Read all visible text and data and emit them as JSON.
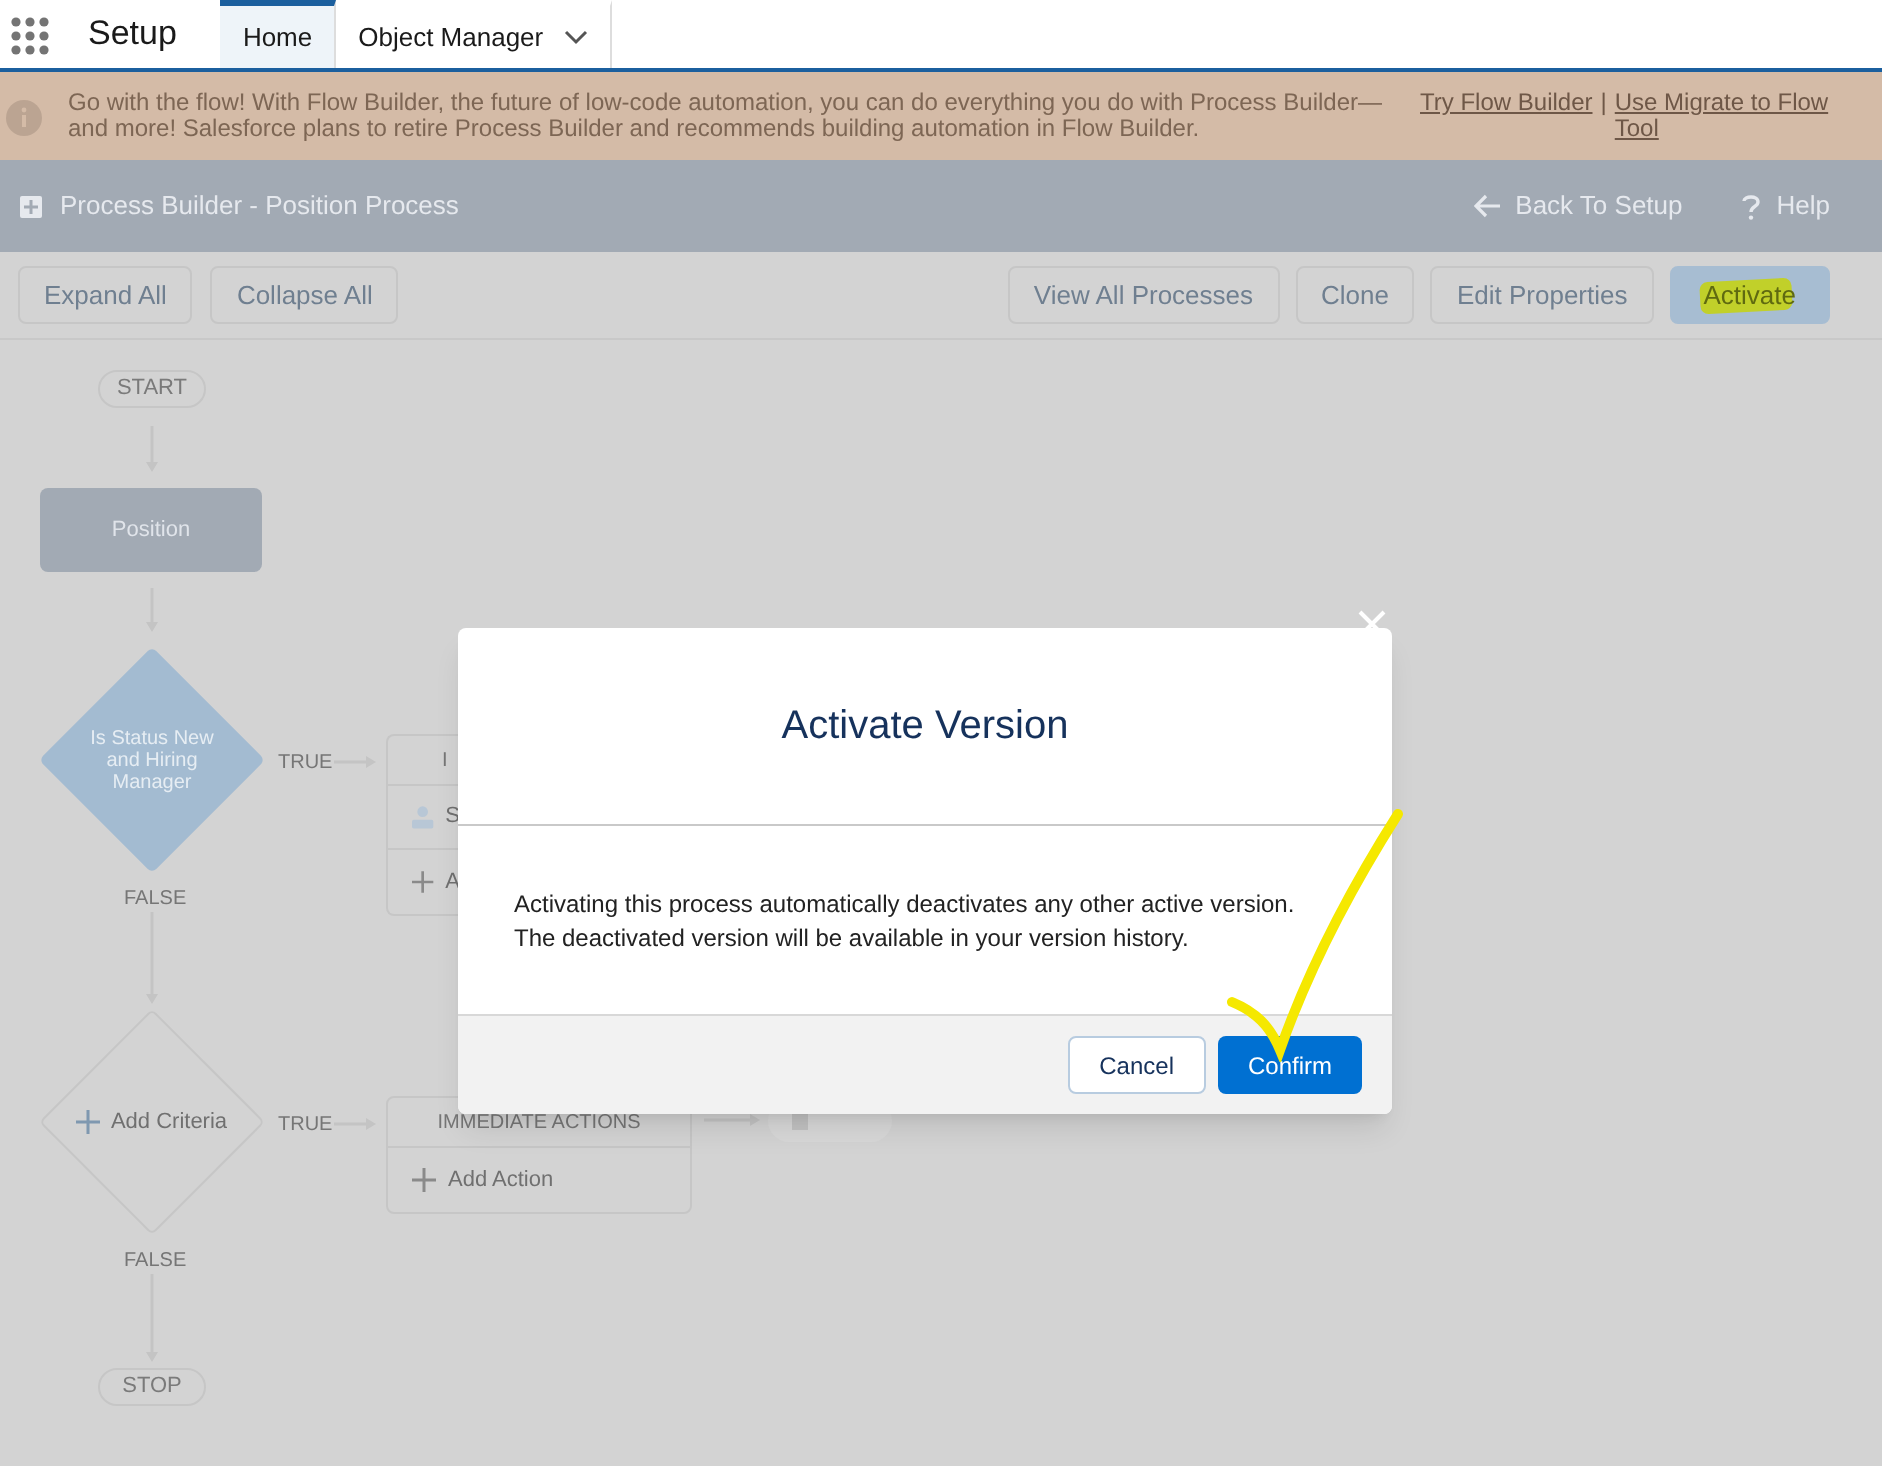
{
  "header": {
    "app_name": "Setup",
    "tabs": [
      {
        "label": "Home",
        "selected": true,
        "has_menu": false
      },
      {
        "label": "Object Manager",
        "selected": false,
        "has_menu": true
      }
    ]
  },
  "banner": {
    "message": "Go with the flow! With Flow Builder, the future of low-code automation, you can do everything you do with Process Builder— and more! Salesforce plans to retire Process Builder and recommends building automation in Flow Builder.",
    "links": [
      "Try Flow Builder",
      "Use Migrate to Flow Tool"
    ],
    "separator": "|"
  },
  "title_bar": {
    "title": "Process Builder - Position Process",
    "back": "Back To Setup",
    "help": "Help"
  },
  "toolbar": {
    "left": [
      {
        "label": "Expand All",
        "kind": "neutral"
      },
      {
        "label": "Collapse All",
        "kind": "neutral"
      }
    ],
    "right": [
      {
        "label": "View All Processes",
        "kind": "neutral"
      },
      {
        "label": "Clone",
        "kind": "neutral"
      },
      {
        "label": "Edit Properties",
        "kind": "neutral"
      },
      {
        "label": "Activate",
        "kind": "brand"
      }
    ]
  },
  "canvas": {
    "start": "START",
    "object": "Position",
    "criteria": [
      {
        "label": "Is Status New and Hiring Manager",
        "kind": "defined",
        "true_label": "TRUE",
        "false_label": "FALSE",
        "actions": {
          "header": "I",
          "rows": [
            {
              "kind": "action",
              "label": "S"
            },
            {
              "kind": "add",
              "label": "A"
            }
          ]
        }
      },
      {
        "label": "Add Criteria",
        "kind": "add",
        "true_label": "TRUE",
        "false_label": "FALSE",
        "actions": {
          "header": "IMMEDIATE ACTIONS",
          "rows": [
            {
              "kind": "add",
              "label": "Add Action"
            }
          ]
        },
        "has_next": true
      }
    ],
    "stop": "STOP"
  },
  "dialog": {
    "title": "Activate Version",
    "message": "Activating this process automatically deactivates any other active version. The deactivated version will be available in your version history.",
    "buttons": [
      {
        "label": "Cancel",
        "kind": "neutral"
      },
      {
        "label": "Confirm",
        "kind": "brand"
      }
    ]
  }
}
